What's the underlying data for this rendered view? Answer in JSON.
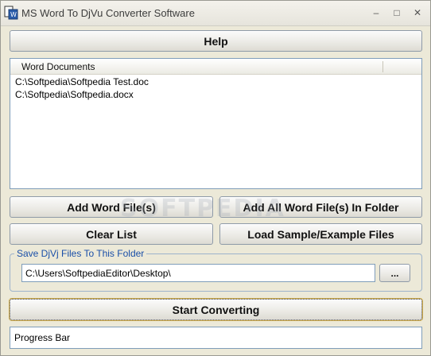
{
  "window": {
    "title": "MS Word To DjVu Converter Software",
    "controls": {
      "minimize": "–",
      "maximize": "□",
      "close": "✕"
    }
  },
  "buttons": {
    "help": "Help",
    "add_files": "Add Word File(s)",
    "add_folder": "Add All Word File(s) In Folder",
    "clear_list": "Clear List",
    "load_sample": "Load Sample/Example Files",
    "browse": "...",
    "start": "Start Converting"
  },
  "file_list": {
    "column_header": "Word Documents",
    "rows": [
      "C:\\Softpedia\\Softpedia Test.doc",
      "C:\\Softpedia\\Softpedia.docx"
    ]
  },
  "output": {
    "group_label": "Save DjVj Files To This Folder",
    "folder_path": "C:\\Users\\SoftpediaEditor\\Desktop\\"
  },
  "progress": {
    "label": "Progress Bar"
  },
  "watermark": "SOFTPEDIA",
  "colors": {
    "accent": "#1a4fa8",
    "border": "#7f9db9",
    "window_bg": "#ece9d8"
  },
  "icons": {
    "app": "word-djvu-app-icon"
  }
}
